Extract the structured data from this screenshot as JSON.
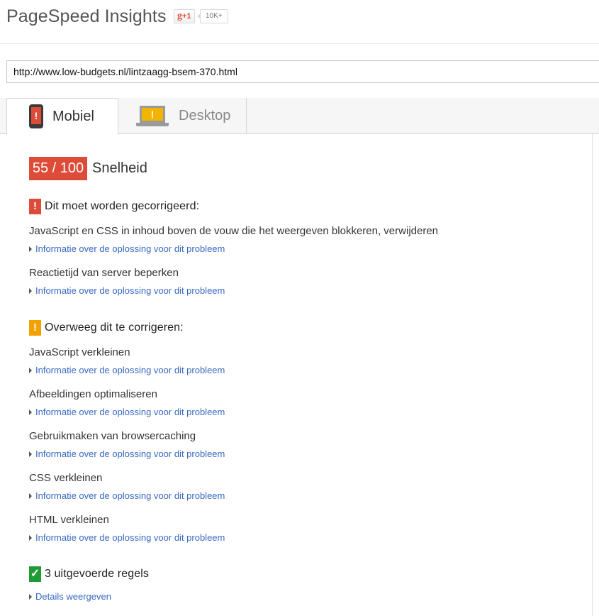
{
  "header": {
    "title": "PageSpeed Insights",
    "gplus_label": "+1",
    "gplus_glyph": "g",
    "share_count": "10K+"
  },
  "url_input": {
    "value": "http://www.low-budgets.nl/lintzaagg-bsem-370.html"
  },
  "tabs": [
    {
      "label": "Mobiel",
      "icon": "phone-warning-icon",
      "active": true
    },
    {
      "label": "Desktop",
      "icon": "desktop-warning-icon",
      "active": false
    }
  ],
  "score": {
    "value": "55 / 100",
    "label": "Snelheid",
    "color": "#dd4b39"
  },
  "sections": {
    "must_fix": {
      "icon": "red-exclamation-icon",
      "glyph": "!",
      "title": "Dit moet worden gecorrigeerd:",
      "color": "#dd4b39",
      "rules": [
        {
          "title": "JavaScript en CSS in inhoud boven de vouw die het weergeven blokkeren, verwijderen",
          "link": "Informatie over de oplossing voor dit probleem"
        },
        {
          "title": "Reactietijd van server beperken",
          "link": "Informatie over de oplossing voor dit probleem"
        }
      ]
    },
    "consider_fix": {
      "icon": "orange-exclamation-icon",
      "glyph": "!",
      "title": "Overweeg dit te corrigeren:",
      "color": "#f1a100",
      "rules": [
        {
          "title": "JavaScript verkleinen",
          "link": "Informatie over de oplossing voor dit probleem"
        },
        {
          "title": "Afbeeldingen optimaliseren",
          "link": "Informatie over de oplossing voor dit probleem"
        },
        {
          "title": "Gebruikmaken van browsercaching",
          "link": "Informatie over de oplossing voor dit probleem"
        },
        {
          "title": "CSS verkleinen",
          "link": "Informatie over de oplossing voor dit probleem"
        },
        {
          "title": "HTML verkleinen",
          "link": "Informatie over de oplossing voor dit probleem"
        }
      ]
    },
    "passed": {
      "icon": "green-check-icon",
      "glyph": "✓",
      "title": "3 uitgevoerde regels",
      "color": "#1f9b36",
      "link": "Details weergeven"
    }
  }
}
